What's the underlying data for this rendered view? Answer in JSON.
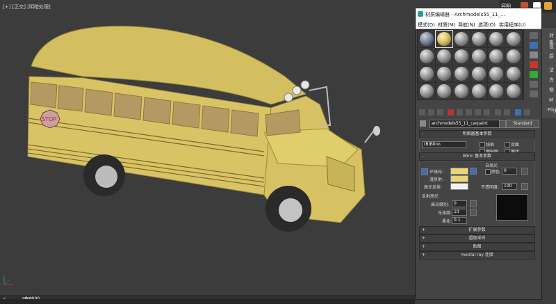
{
  "viewport": {
    "label": "[+] [正交] [明暗处理]",
    "stop_sign_text": "STOP"
  },
  "app_strip": {
    "label": "容明"
  },
  "command_panel": {
    "items": [
      "对象...",
      "设",
      "原",
      "法",
      "方",
      "修",
      "M",
      "Flight"
    ]
  },
  "material_editor": {
    "title": "材质编辑器 - Archmodels55_11_...",
    "menu": [
      "模式(D)",
      "材质(M)",
      "导航(N)",
      "选项(O)",
      "实用程序(U)"
    ],
    "material_name": "archmodels55_11_carpaint",
    "material_type": "Standard",
    "shader_rollout": {
      "title": "明暗器基本参数",
      "shader": "(B)Blinn",
      "checkboxes": [
        "线框",
        "双面",
        "面贴图",
        "面状"
      ]
    },
    "blinn_rollout": {
      "title": "Blinn 基本参数",
      "self_illum_group": "自发光",
      "color_label": "颜色",
      "color_value": "0",
      "ambient_label": "环境光:",
      "diffuse_label": "漫反射:",
      "specular_label": "高光反射:",
      "opacity_label": "不透明度:",
      "opacity_value": "100",
      "highlights_group": "反射高光",
      "spec_level_label": "高光级别:",
      "spec_level_value": "0",
      "gloss_label": "光泽度:",
      "gloss_value": "10",
      "soften_label": "柔化:",
      "soften_value": "0.1",
      "ambient_color": "#e9d677",
      "diffuse_color": "#e9d677",
      "specular_color": "#f2f2f2"
    },
    "rollouts": [
      "扩展参数",
      "超级采样",
      "贴图",
      "mental ray 连接"
    ]
  },
  "timeline": {
    "frame": "0 / 100"
  },
  "colors": {
    "bus_yellow": "#d9c465",
    "viewport_bg": "#3c3c3c"
  }
}
